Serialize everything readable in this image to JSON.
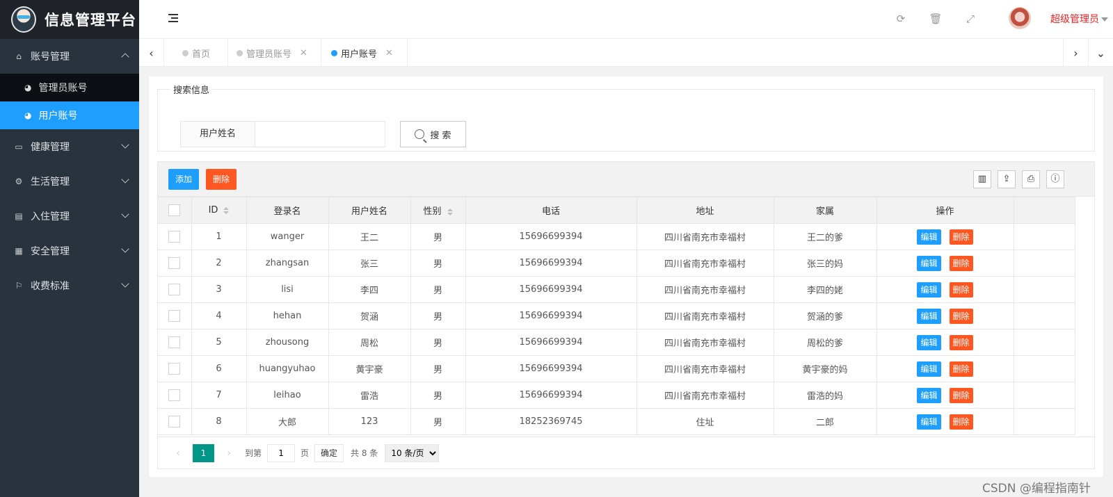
{
  "app": {
    "title": "信息管理平台"
  },
  "sidebar": {
    "groups": [
      {
        "label": "账号管理",
        "icon": "home-icon",
        "expanded": true,
        "items": [
          {
            "label": "管理员账号",
            "active": false
          },
          {
            "label": "用户账号",
            "active": true
          }
        ]
      },
      {
        "label": "健康管理",
        "icon": "window-icon"
      },
      {
        "label": "生活管理",
        "icon": "gears-icon"
      },
      {
        "label": "入住管理",
        "icon": "file-icon"
      },
      {
        "label": "安全管理",
        "icon": "calendar-icon"
      },
      {
        "label": "收费标准",
        "icon": "flag-icon"
      }
    ]
  },
  "header": {
    "user_name": "超级管理员"
  },
  "tabs": [
    {
      "label": "首页",
      "closable": false,
      "active": false
    },
    {
      "label": "管理员账号",
      "closable": true,
      "active": false
    },
    {
      "label": "用户账号",
      "closable": true,
      "active": true
    }
  ],
  "search": {
    "legend": "搜索信息",
    "field_label": "用户姓名",
    "field_value": "",
    "button_label": "搜 索"
  },
  "toolbar": {
    "add_label": "添加",
    "delete_label": "删除"
  },
  "table": {
    "columns": [
      "ID",
      "登录名",
      "用户姓名",
      "性别",
      "电话",
      "地址",
      "家属",
      "操作"
    ],
    "edit_label": "编辑",
    "delete_label": "删除",
    "rows": [
      [
        "1",
        "wanger",
        "王二",
        "男",
        "15696699394",
        "四川省南充市幸福村",
        "王二的爹"
      ],
      [
        "2",
        "zhangsan",
        "张三",
        "男",
        "15696699394",
        "四川省南充市幸福村",
        "张三的妈"
      ],
      [
        "3",
        "lisi",
        "李四",
        "男",
        "15696699394",
        "四川省南充市幸福村",
        "李四的姥"
      ],
      [
        "4",
        "hehan",
        "贺涵",
        "男",
        "15696699394",
        "四川省南充市幸福村",
        "贺涵的爹"
      ],
      [
        "5",
        "zhousong",
        "周松",
        "男",
        "15696699394",
        "四川省南充市幸福村",
        "周松的爹"
      ],
      [
        "6",
        "huangyuhao",
        "黄宇豪",
        "男",
        "15696699394",
        "四川省南充市幸福村",
        "黄宇豪的妈"
      ],
      [
        "7",
        "leihao",
        "雷浩",
        "男",
        "15696699394",
        "四川省南充市幸福村",
        "雷浩的妈"
      ],
      [
        "8",
        "大郎",
        "123",
        "男",
        "18252369745",
        "住址",
        "二郎"
      ]
    ]
  },
  "pager": {
    "current": "1",
    "goto_prefix": "到第",
    "goto_value": "1",
    "goto_suffix": "页",
    "confirm_label": "确定",
    "total_text": "共 8 条",
    "page_size": "10 条/页"
  },
  "watermark": "CSDN @编程指南针",
  "colors": {
    "sidebar": "#28333e",
    "primary": "#1e9fff",
    "danger": "#ff5722",
    "pager": "#009688",
    "user_name": "#ee2222"
  }
}
